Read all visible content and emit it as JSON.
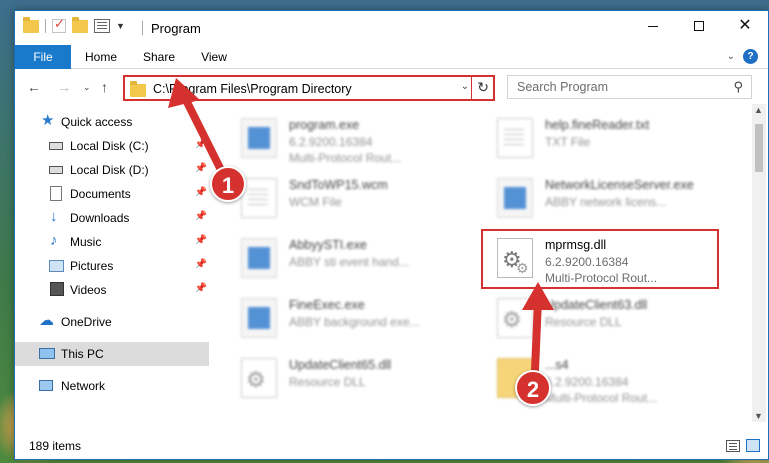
{
  "window": {
    "title": "Program",
    "buttons": {
      "minimize": "minimize",
      "maximize": "maximize",
      "close": "✕"
    }
  },
  "ribbon": {
    "tabs": [
      {
        "label": "File"
      },
      {
        "label": "Home"
      },
      {
        "label": "Share"
      },
      {
        "label": "View"
      }
    ],
    "help": "?"
  },
  "address": {
    "path": "C:\\Program Files\\Program Directory"
  },
  "search": {
    "placeholder": "Search Program"
  },
  "sidebar": {
    "items": [
      {
        "label": "Quick access",
        "icon": "star-icon"
      },
      {
        "label": "Local Disk (C:)",
        "icon": "drive-icon",
        "pinned": true
      },
      {
        "label": "Local Disk (D:)",
        "icon": "drive-icon",
        "pinned": true
      },
      {
        "label": "Documents",
        "icon": "document-icon",
        "pinned": true
      },
      {
        "label": "Downloads",
        "icon": "download-icon",
        "pinned": true
      },
      {
        "label": "Music",
        "icon": "music-icon",
        "pinned": true
      },
      {
        "label": "Pictures",
        "icon": "picture-icon",
        "pinned": true
      },
      {
        "label": "Videos",
        "icon": "video-icon",
        "pinned": true
      },
      {
        "label": "OneDrive",
        "icon": "cloud-icon"
      },
      {
        "label": "This PC",
        "icon": "computer-icon",
        "selected": true
      },
      {
        "label": "Network",
        "icon": "network-icon"
      }
    ]
  },
  "files": [
    {
      "name": "program.exe",
      "line2": "6.2.9200.16384",
      "line3": "Multi-Protocol Rout...",
      "icon": "exe-icon",
      "blurred": true
    },
    {
      "name": "help.fineReader.txt",
      "line2": "TXT File",
      "line3": "",
      "icon": "text-file-icon",
      "blurred": true
    },
    {
      "name": "SndToWP15.wcm",
      "line2": "WCM File",
      "line3": "",
      "icon": "text-file-icon",
      "blurred": true
    },
    {
      "name": "NetworkLicenseServer.exe",
      "line2": "ABBY network licens...",
      "line3": "",
      "icon": "exe-icon",
      "blurred": true
    },
    {
      "name": "AbbyySTI.exe",
      "line2": "ABBY sti event hand...",
      "line3": "",
      "icon": "exe-icon",
      "blurred": true
    },
    {
      "name": "mprmsg.dll",
      "line2": "6.2.9200.16384",
      "line3": "Multi-Protocol Rout...",
      "icon": "dll-icon",
      "blurred": false
    },
    {
      "name": "FineExec.exe",
      "line2": "ABBY background exe...",
      "line3": "",
      "icon": "exe-icon",
      "blurred": true
    },
    {
      "name": "UpdateClient63.dll",
      "line2": "Resource DLL",
      "line3": "",
      "icon": "dll-icon",
      "blurred": true
    },
    {
      "name": "UpdateClient65.dll",
      "line2": "Resource DLL",
      "line3": "",
      "icon": "dll-icon",
      "blurred": true
    },
    {
      "name": "...s4",
      "line2": "6.2.9200.16384",
      "line3": "Multi-Protocol Rout...",
      "icon": "folder-icon",
      "blurred": true
    }
  ],
  "status": {
    "item_count": "189 items"
  },
  "callouts": {
    "step1": "1",
    "step2": "2"
  },
  "colors": {
    "accent": "#1979ca",
    "highlight": "#d5312e"
  }
}
